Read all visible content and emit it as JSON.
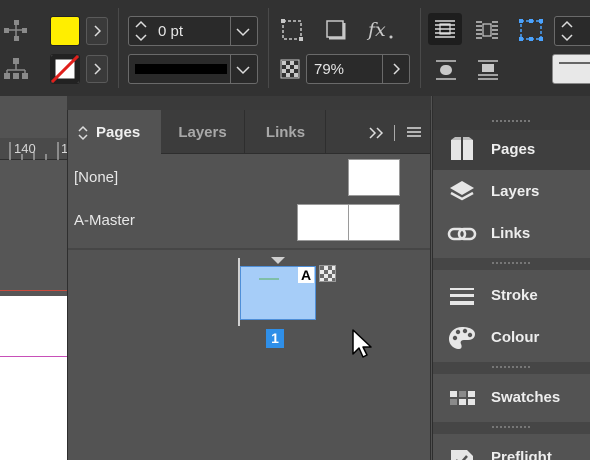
{
  "control_bar": {
    "stroke_weight": "0 pt",
    "opacity": "79%",
    "colors": {
      "fill": "#ffee00",
      "bar_bg": "#323232"
    }
  },
  "ruler": {
    "mark": "140",
    "mark2": "1"
  },
  "pages_panel": {
    "tabs": [
      {
        "label": "Pages"
      },
      {
        "label": "Layers"
      },
      {
        "label": "Links"
      }
    ],
    "masters": [
      {
        "label": "[None]"
      },
      {
        "label": "A-Master"
      }
    ],
    "page": {
      "master_prefix": "A",
      "number": "1"
    }
  },
  "dock": {
    "items": [
      {
        "label": "Pages",
        "icon": "pages-icon"
      },
      {
        "label": "Layers",
        "icon": "layers-icon"
      },
      {
        "label": "Links",
        "icon": "links-icon"
      },
      {
        "label": "Stroke",
        "icon": "stroke-icon"
      },
      {
        "label": "Colour",
        "icon": "palette-icon"
      },
      {
        "label": "Swatches",
        "icon": "swatches-icon"
      },
      {
        "label": "Preflight",
        "icon": "preflight-icon"
      }
    ]
  }
}
